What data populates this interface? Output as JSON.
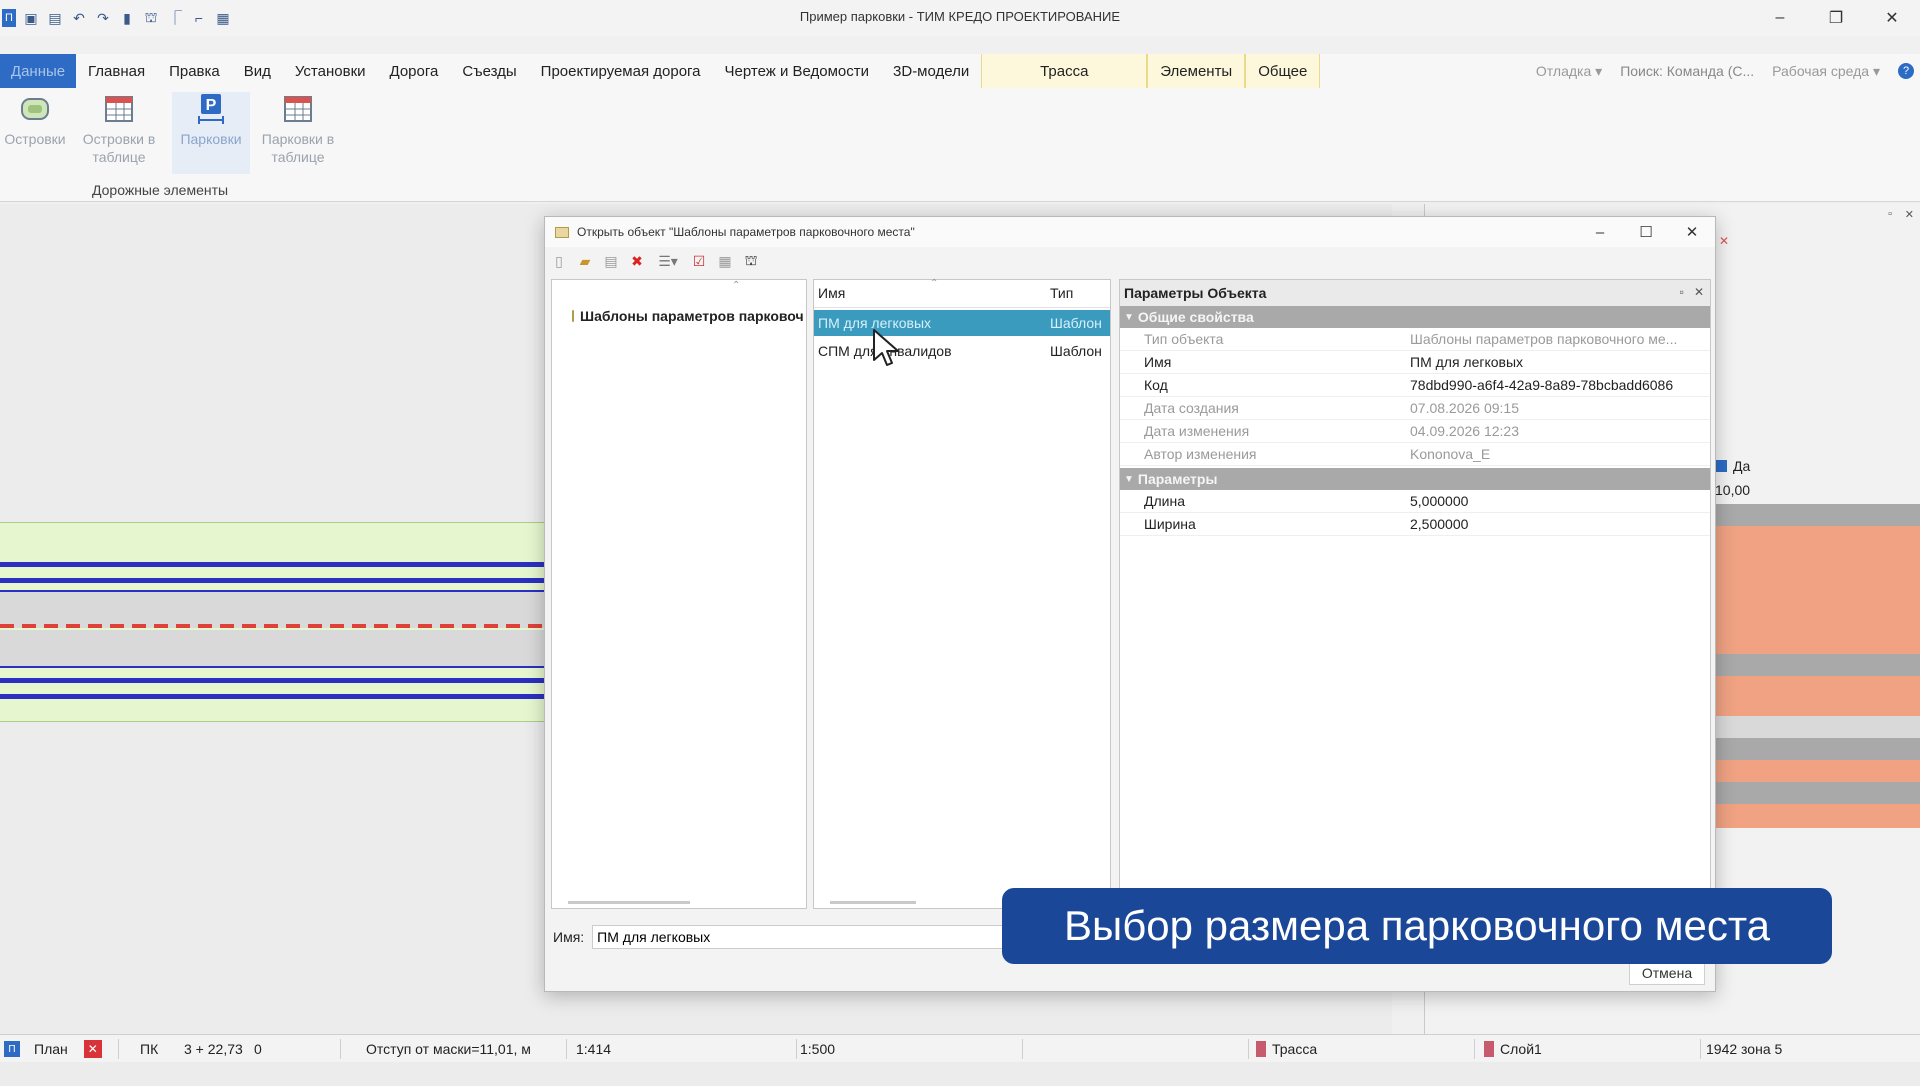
{
  "window": {
    "title": "Пример парковки - ТИМ КРЕДО ПРОЕКТИРОВАНИЕ"
  },
  "menu": {
    "file": "Данные",
    "items": [
      "Главная",
      "Правка",
      "Вид",
      "Установки",
      "Дорога",
      "Съезды",
      "Проектируемая дорога",
      "Чертеж и Ведомости",
      "3D-модели"
    ],
    "context_tabs": [
      "Трасса",
      "Элементы",
      "Общее"
    ],
    "debug": "Отладка",
    "search": "Поиск: Команда (С...",
    "workspace": "Рабочая среда"
  },
  "ribbon": {
    "buttons": [
      {
        "label1": "Островки",
        "label2": ""
      },
      {
        "label1": "Островки в",
        "label2": "таблице"
      },
      {
        "label1": "Парковки",
        "label2": ""
      },
      {
        "label1": "Парковки в",
        "label2": "таблице"
      }
    ],
    "group_label": "Дорожные элементы"
  },
  "dialog": {
    "title": "Открыть объект \"Шаблоны параметров парковочного места\"",
    "tree_root": "Шаблоны параметров парковочного места",
    "list_columns": {
      "name": "Имя",
      "type": "Тип"
    },
    "list_rows": [
      {
        "name": "ПМ для легковых",
        "type": "Шаблон",
        "selected": true
      },
      {
        "name": "СПМ для инвалидов",
        "type": "Шаблон",
        "selected": false
      }
    ],
    "props": {
      "header": "Параметры Объекта",
      "cat_general": "Общие свойства",
      "general": [
        {
          "name": "Тип объекта",
          "value": "Шаблоны параметров парковочного ме...",
          "readonly": true
        },
        {
          "name": "Имя",
          "value": "ПМ для легковых",
          "readonly": false
        },
        {
          "name": "Код",
          "value": "78dbd990-a6f4-42a9-8a89-78bcbadd6086",
          "readonly": false
        },
        {
          "name": "Дата создания",
          "value": "07.08.2026 09:15",
          "readonly": true
        },
        {
          "name": "Дата изменения",
          "value": "04.09.2026 12:23",
          "readonly": true
        },
        {
          "name": "Автор изменения",
          "value": "Kononova_E",
          "readonly": true
        }
      ],
      "cat_params": "Параметры",
      "params": [
        {
          "name": "Длина",
          "value": "5,000000"
        },
        {
          "name": "Ширина",
          "value": "2,500000"
        }
      ]
    },
    "name_label": "Имя:",
    "name_value": "ПМ для легковых",
    "cancel": "Отмена"
  },
  "right_panel": {
    "checkbox_label": "Да",
    "value": "10,00"
  },
  "caption": "Выбор размера парковочного места",
  "status": {
    "view": "План",
    "pk_label": "ПК",
    "pk_value": "3 + 22,73",
    "pk_extra": "0",
    "offset": "Отступ от маски=11,01, м",
    "scale1": "1:414",
    "scale2": "1:500",
    "layer_trassa": "Трасса",
    "layer": "Слой1",
    "zone": "1942 зона 5"
  },
  "colors": {
    "accent": "#2d6bc4",
    "selection": "#3a9bbf",
    "caption_bg": "#1a4797",
    "road_lane": "#2b2fc2",
    "center_line": "#e0403a",
    "panel_orange": "#f0a283"
  }
}
